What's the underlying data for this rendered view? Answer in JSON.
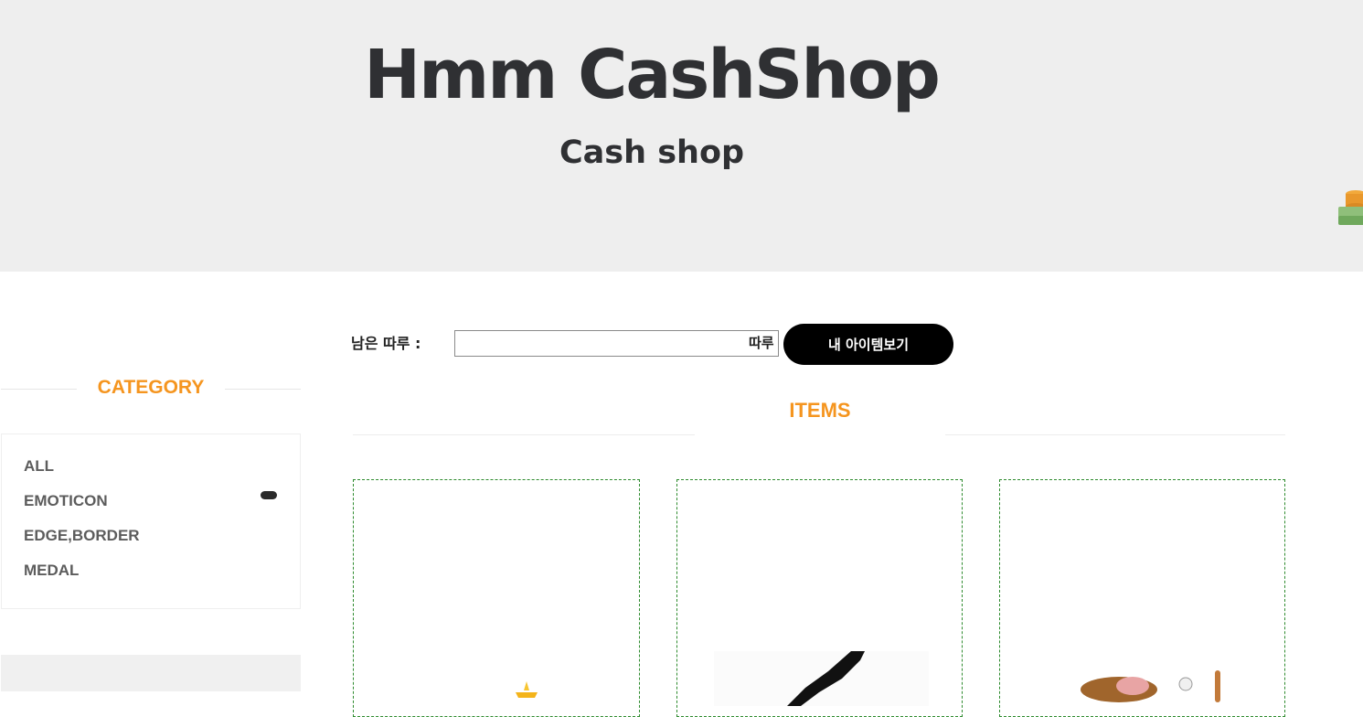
{
  "header": {
    "title": "Hmm CashShop",
    "subtitle": "Cash shop",
    "cash_icon": "money-stack-icon"
  },
  "sidebar": {
    "title": "CATEGORY",
    "items": [
      {
        "label": "ALL"
      },
      {
        "label": "EMOTICON"
      },
      {
        "label": "EDGE,BORDER"
      },
      {
        "label": "MEDAL"
      }
    ]
  },
  "points": {
    "label": "남은 따루 :",
    "value": "",
    "unit": "따루",
    "my_items_button": "내 아이템보기"
  },
  "items": {
    "title": "ITEMS",
    "cards": [
      {
        "image": "crown-sparkle-item-image"
      },
      {
        "image": "black-silhouette-item-image"
      },
      {
        "image": "cartoon-character-item-image"
      }
    ]
  },
  "colors": {
    "accent": "#f5951f",
    "hero_bg": "#eeeeee",
    "card_border": "#2e8b2e",
    "button_bg": "#000000"
  }
}
